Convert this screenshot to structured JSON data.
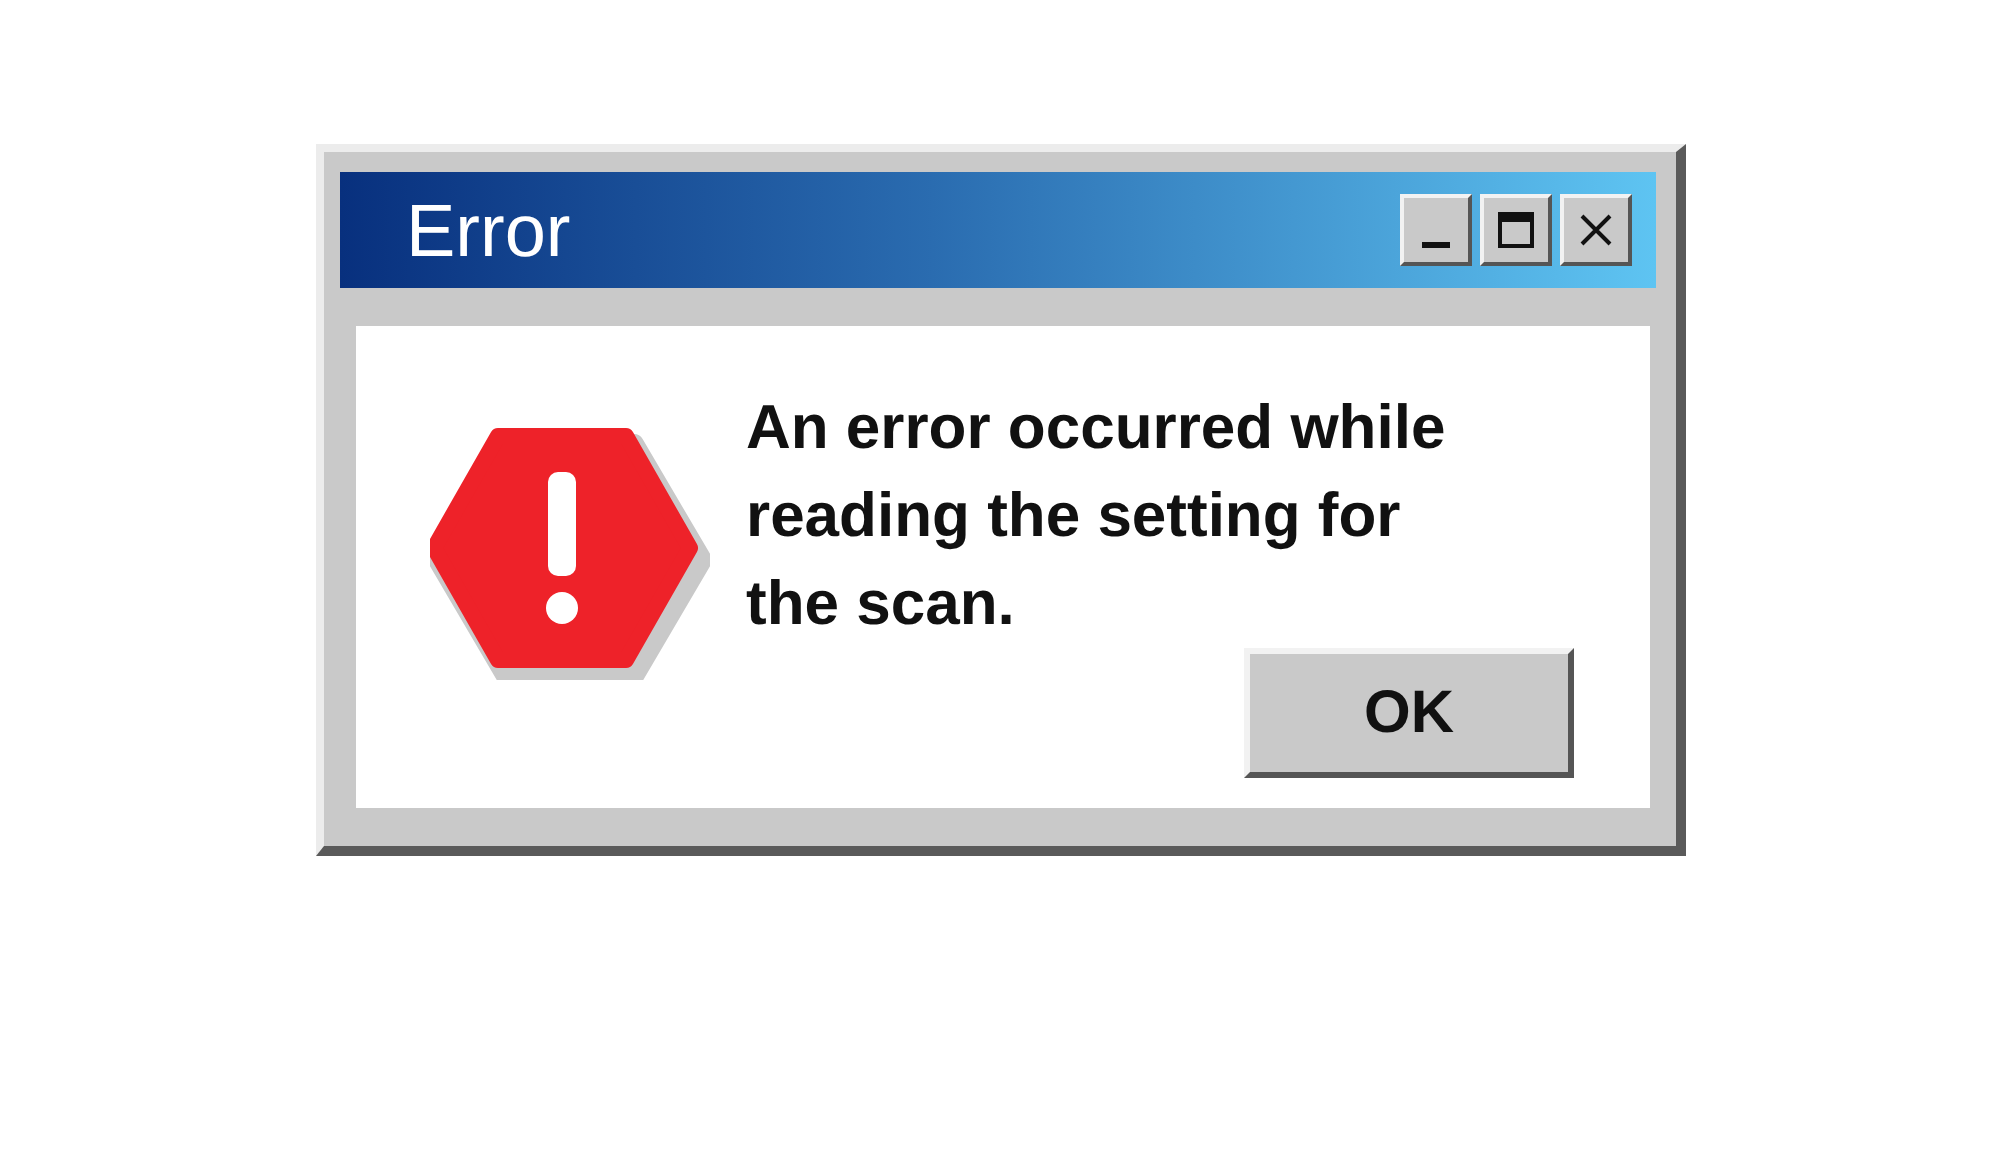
{
  "window": {
    "title": "Error"
  },
  "title_buttons": [
    {
      "kind": "minimize"
    },
    {
      "kind": "maximize"
    },
    {
      "kind": "close"
    }
  ],
  "message": "An error occurred while reading the setting for the scan.",
  "buttons": [
    "OK"
  ]
}
